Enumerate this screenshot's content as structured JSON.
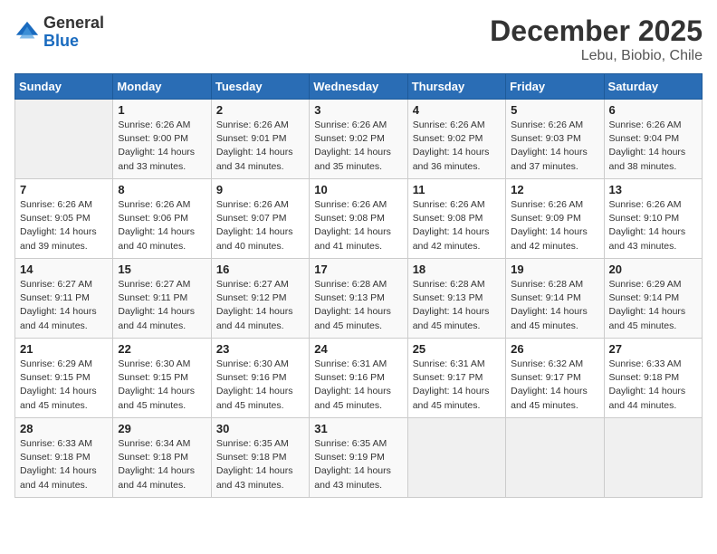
{
  "logo": {
    "general": "General",
    "blue": "Blue"
  },
  "title": "December 2025",
  "location": "Lebu, Biobio, Chile",
  "days_of_week": [
    "Sunday",
    "Monday",
    "Tuesday",
    "Wednesday",
    "Thursday",
    "Friday",
    "Saturday"
  ],
  "weeks": [
    [
      {
        "num": "",
        "info": ""
      },
      {
        "num": "1",
        "info": "Sunrise: 6:26 AM\nSunset: 9:00 PM\nDaylight: 14 hours\nand 33 minutes."
      },
      {
        "num": "2",
        "info": "Sunrise: 6:26 AM\nSunset: 9:01 PM\nDaylight: 14 hours\nand 34 minutes."
      },
      {
        "num": "3",
        "info": "Sunrise: 6:26 AM\nSunset: 9:02 PM\nDaylight: 14 hours\nand 35 minutes."
      },
      {
        "num": "4",
        "info": "Sunrise: 6:26 AM\nSunset: 9:02 PM\nDaylight: 14 hours\nand 36 minutes."
      },
      {
        "num": "5",
        "info": "Sunrise: 6:26 AM\nSunset: 9:03 PM\nDaylight: 14 hours\nand 37 minutes."
      },
      {
        "num": "6",
        "info": "Sunrise: 6:26 AM\nSunset: 9:04 PM\nDaylight: 14 hours\nand 38 minutes."
      }
    ],
    [
      {
        "num": "7",
        "info": "Sunrise: 6:26 AM\nSunset: 9:05 PM\nDaylight: 14 hours\nand 39 minutes."
      },
      {
        "num": "8",
        "info": "Sunrise: 6:26 AM\nSunset: 9:06 PM\nDaylight: 14 hours\nand 40 minutes."
      },
      {
        "num": "9",
        "info": "Sunrise: 6:26 AM\nSunset: 9:07 PM\nDaylight: 14 hours\nand 40 minutes."
      },
      {
        "num": "10",
        "info": "Sunrise: 6:26 AM\nSunset: 9:08 PM\nDaylight: 14 hours\nand 41 minutes."
      },
      {
        "num": "11",
        "info": "Sunrise: 6:26 AM\nSunset: 9:08 PM\nDaylight: 14 hours\nand 42 minutes."
      },
      {
        "num": "12",
        "info": "Sunrise: 6:26 AM\nSunset: 9:09 PM\nDaylight: 14 hours\nand 42 minutes."
      },
      {
        "num": "13",
        "info": "Sunrise: 6:26 AM\nSunset: 9:10 PM\nDaylight: 14 hours\nand 43 minutes."
      }
    ],
    [
      {
        "num": "14",
        "info": "Sunrise: 6:27 AM\nSunset: 9:11 PM\nDaylight: 14 hours\nand 44 minutes."
      },
      {
        "num": "15",
        "info": "Sunrise: 6:27 AM\nSunset: 9:11 PM\nDaylight: 14 hours\nand 44 minutes."
      },
      {
        "num": "16",
        "info": "Sunrise: 6:27 AM\nSunset: 9:12 PM\nDaylight: 14 hours\nand 44 minutes."
      },
      {
        "num": "17",
        "info": "Sunrise: 6:28 AM\nSunset: 9:13 PM\nDaylight: 14 hours\nand 45 minutes."
      },
      {
        "num": "18",
        "info": "Sunrise: 6:28 AM\nSunset: 9:13 PM\nDaylight: 14 hours\nand 45 minutes."
      },
      {
        "num": "19",
        "info": "Sunrise: 6:28 AM\nSunset: 9:14 PM\nDaylight: 14 hours\nand 45 minutes."
      },
      {
        "num": "20",
        "info": "Sunrise: 6:29 AM\nSunset: 9:14 PM\nDaylight: 14 hours\nand 45 minutes."
      }
    ],
    [
      {
        "num": "21",
        "info": "Sunrise: 6:29 AM\nSunset: 9:15 PM\nDaylight: 14 hours\nand 45 minutes."
      },
      {
        "num": "22",
        "info": "Sunrise: 6:30 AM\nSunset: 9:15 PM\nDaylight: 14 hours\nand 45 minutes."
      },
      {
        "num": "23",
        "info": "Sunrise: 6:30 AM\nSunset: 9:16 PM\nDaylight: 14 hours\nand 45 minutes."
      },
      {
        "num": "24",
        "info": "Sunrise: 6:31 AM\nSunset: 9:16 PM\nDaylight: 14 hours\nand 45 minutes."
      },
      {
        "num": "25",
        "info": "Sunrise: 6:31 AM\nSunset: 9:17 PM\nDaylight: 14 hours\nand 45 minutes."
      },
      {
        "num": "26",
        "info": "Sunrise: 6:32 AM\nSunset: 9:17 PM\nDaylight: 14 hours\nand 45 minutes."
      },
      {
        "num": "27",
        "info": "Sunrise: 6:33 AM\nSunset: 9:18 PM\nDaylight: 14 hours\nand 44 minutes."
      }
    ],
    [
      {
        "num": "28",
        "info": "Sunrise: 6:33 AM\nSunset: 9:18 PM\nDaylight: 14 hours\nand 44 minutes."
      },
      {
        "num": "29",
        "info": "Sunrise: 6:34 AM\nSunset: 9:18 PM\nDaylight: 14 hours\nand 44 minutes."
      },
      {
        "num": "30",
        "info": "Sunrise: 6:35 AM\nSunset: 9:18 PM\nDaylight: 14 hours\nand 43 minutes."
      },
      {
        "num": "31",
        "info": "Sunrise: 6:35 AM\nSunset: 9:19 PM\nDaylight: 14 hours\nand 43 minutes."
      },
      {
        "num": "",
        "info": ""
      },
      {
        "num": "",
        "info": ""
      },
      {
        "num": "",
        "info": ""
      }
    ]
  ]
}
